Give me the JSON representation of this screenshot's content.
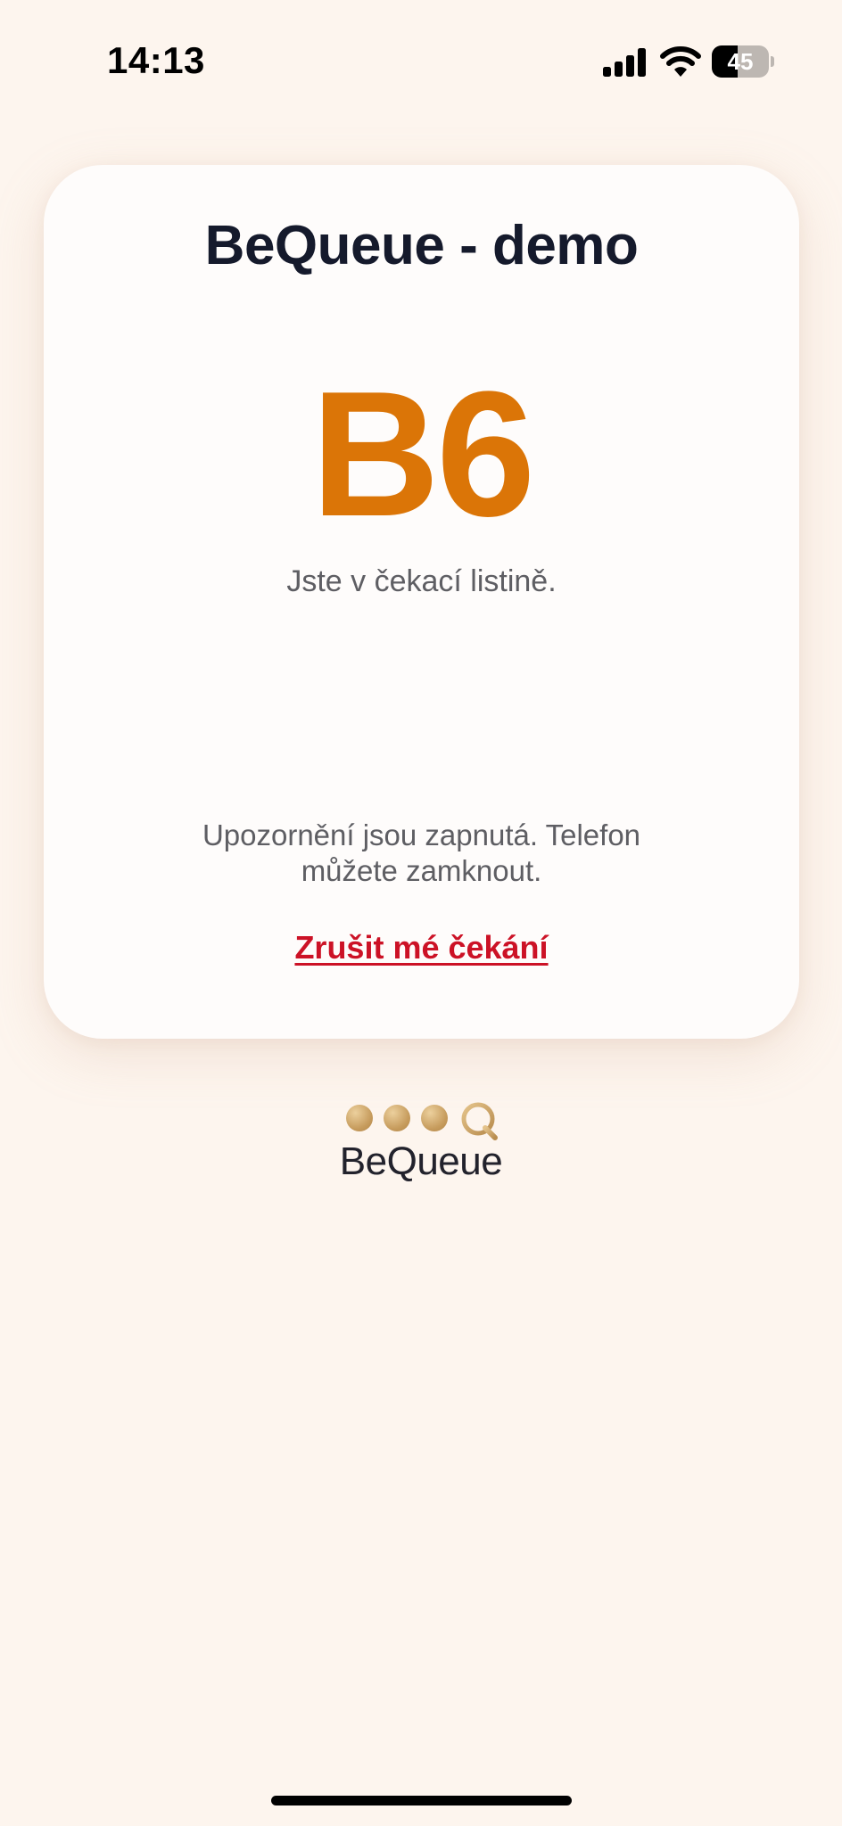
{
  "status_bar": {
    "time": "14:13",
    "battery_level": 45,
    "icons": [
      "signal-icon",
      "wifi-icon",
      "battery-icon"
    ]
  },
  "card": {
    "title": "BeQueue - demo",
    "ticket_number": "B6",
    "waiting_text": "Jste v čekací listině.",
    "notice_text": "Upozornění jsou zapnutá. Telefon můžete zamknout.",
    "cancel_label": "Zrušit mé čekání"
  },
  "logo": {
    "text": "BeQueue"
  },
  "colors": {
    "background": "#fdf5ee",
    "card": "#fefcfb",
    "title": "#151a2c",
    "ticket": "#db7507",
    "body_text": "#5e5e63",
    "cancel": "#cc1226",
    "logo_gold": "#c59a5b"
  }
}
